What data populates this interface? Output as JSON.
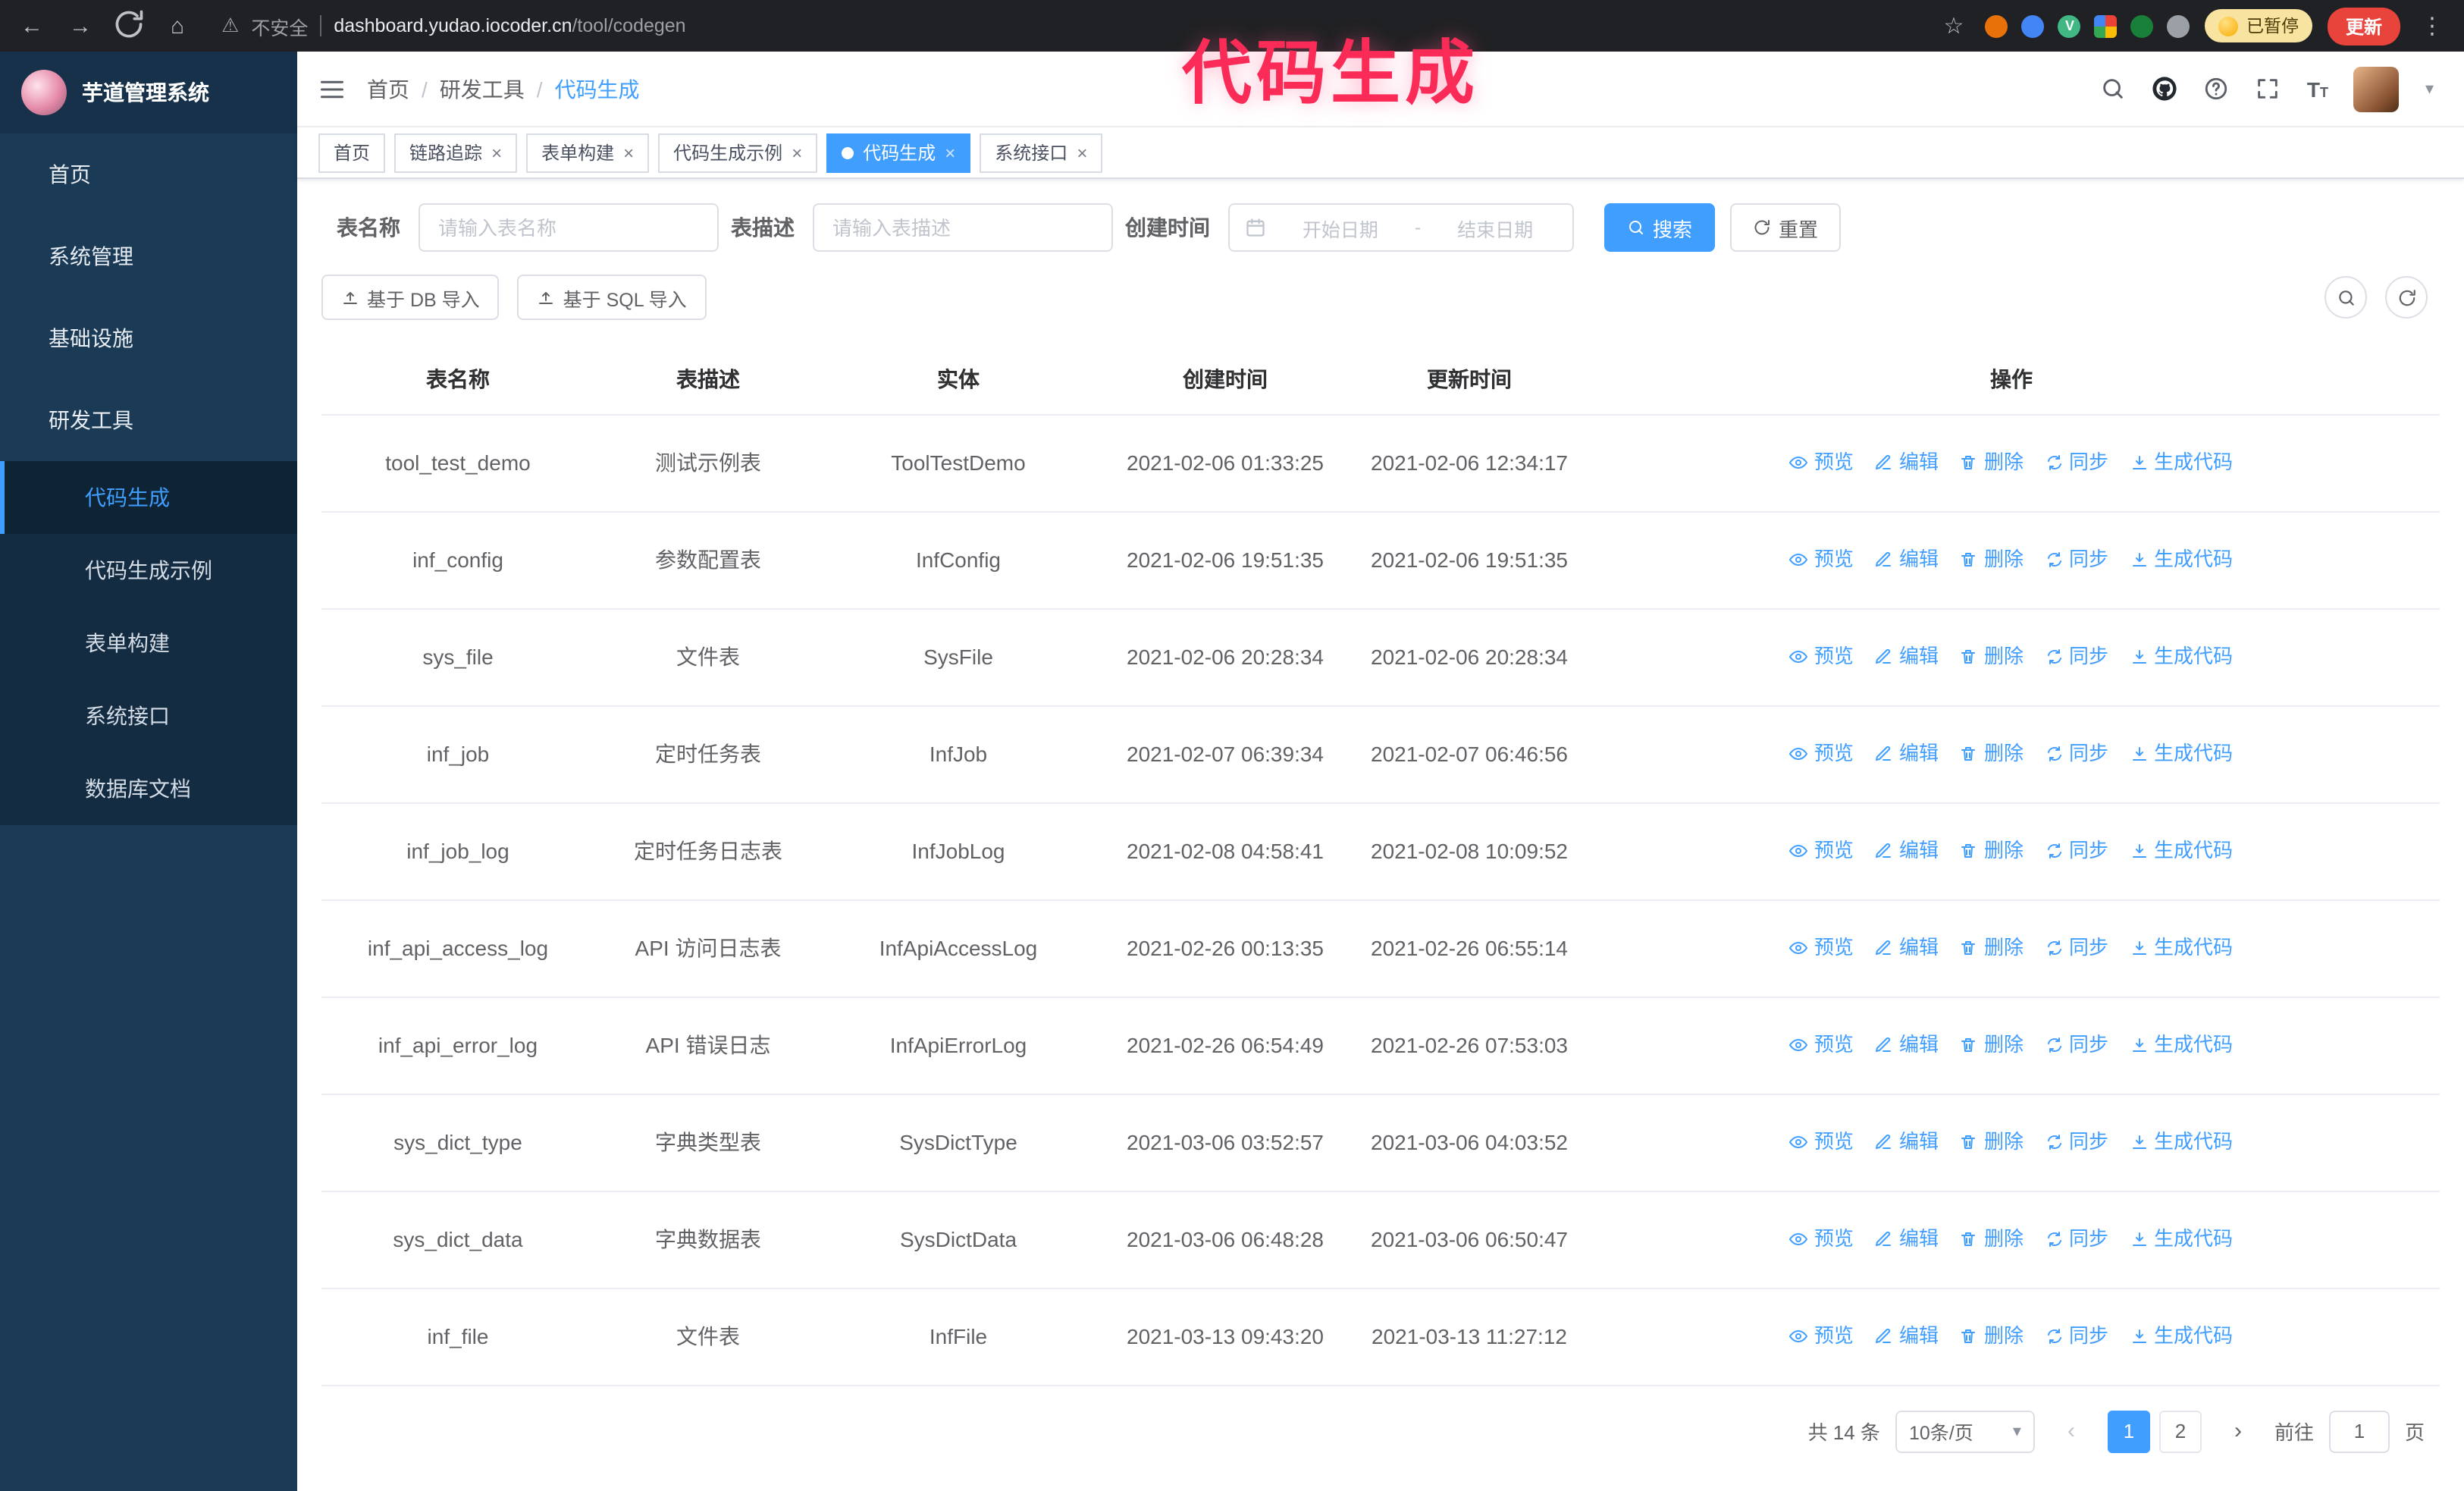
{
  "browser": {
    "security_label": "不安全",
    "url_host": "dashboard.yudao.iocoder.cn",
    "url_path": "/tool/codegen",
    "paused_label": "已暂停",
    "update_label": "更新",
    "extension_icons": [
      "orange-extension-icon",
      "blue-drop-extension-icon",
      "vue-devtools-icon",
      "google-apps-grid-icon",
      "green-extension-icon",
      "puzzle-extension-icon"
    ]
  },
  "annotation": {
    "text": "代码生成",
    "color": "#fb2b57"
  },
  "sidebar": {
    "app_title": "芋道管理系统",
    "items": [
      {
        "id": "home",
        "label": "首页",
        "icon": "dashboard",
        "expandable": false,
        "expanded": false
      },
      {
        "id": "system",
        "label": "系统管理",
        "icon": "gear",
        "expandable": true,
        "expanded": false
      },
      {
        "id": "infra",
        "label": "基础设施",
        "icon": "monitor",
        "expandable": true,
        "expanded": false
      },
      {
        "id": "devtools",
        "label": "研发工具",
        "icon": "toolbox",
        "expandable": true,
        "expanded": true
      }
    ],
    "submenu": [
      {
        "id": "codegen",
        "label": "代码生成",
        "icon": "code",
        "active": true
      },
      {
        "id": "codegen-example",
        "label": "代码生成示例",
        "icon": "shield-check",
        "active": false
      },
      {
        "id": "form-builder",
        "label": "表单构建",
        "icon": "table",
        "active": false
      },
      {
        "id": "api",
        "label": "系统接口",
        "icon": "api-list",
        "active": false
      },
      {
        "id": "db-doc",
        "label": "数据库文档",
        "icon": "grid",
        "active": false
      }
    ]
  },
  "navbar": {
    "breadcrumb": [
      "首页",
      "研发工具",
      "代码生成"
    ]
  },
  "tabs": [
    {
      "id": "home",
      "label": "首页",
      "closable": false,
      "active": false
    },
    {
      "id": "trace",
      "label": "链路追踪",
      "closable": true,
      "active": false
    },
    {
      "id": "form-builder",
      "label": "表单构建",
      "closable": true,
      "active": false
    },
    {
      "id": "codegen-example",
      "label": "代码生成示例",
      "closable": true,
      "active": false
    },
    {
      "id": "codegen",
      "label": "代码生成",
      "closable": true,
      "active": true
    },
    {
      "id": "api",
      "label": "系统接口",
      "closable": true,
      "active": false
    }
  ],
  "filters": {
    "table_name_label": "表名称",
    "table_name_placeholder": "请输入表名称",
    "table_desc_label": "表描述",
    "table_desc_placeholder": "请输入表描述",
    "create_time_label": "创建时间",
    "start_date_placeholder": "开始日期",
    "range_separator": "-",
    "end_date_placeholder": "结束日期",
    "search_label": "搜索",
    "reset_label": "重置"
  },
  "toolbar": {
    "import_db_label": "基于 DB 导入",
    "import_sql_label": "基于 SQL 导入"
  },
  "table": {
    "columns": [
      "表名称",
      "表描述",
      "实体",
      "创建时间",
      "更新时间",
      "操作"
    ],
    "actions": [
      {
        "id": "preview",
        "label": "预览",
        "icon": "eye"
      },
      {
        "id": "edit",
        "label": "编辑",
        "icon": "edit"
      },
      {
        "id": "delete",
        "label": "删除",
        "icon": "trash"
      },
      {
        "id": "sync",
        "label": "同步",
        "icon": "sync"
      },
      {
        "id": "generate",
        "label": "生成代码",
        "icon": "generate"
      }
    ],
    "rows": [
      {
        "name": "tool_test_demo",
        "desc": "测试示例表",
        "entity": "ToolTestDemo",
        "created": "2021-02-06 01:33:25",
        "updated": "2021-02-06 12:34:17"
      },
      {
        "name": "inf_config",
        "desc": "参数配置表",
        "entity": "InfConfig",
        "created": "2021-02-06 19:51:35",
        "updated": "2021-02-06 19:51:35"
      },
      {
        "name": "sys_file",
        "desc": "文件表",
        "entity": "SysFile",
        "created": "2021-02-06 20:28:34",
        "updated": "2021-02-06 20:28:34"
      },
      {
        "name": "inf_job",
        "desc": "定时任务表",
        "entity": "InfJob",
        "created": "2021-02-07 06:39:34",
        "updated": "2021-02-07 06:46:56"
      },
      {
        "name": "inf_job_log",
        "desc": "定时任务日志表",
        "entity": "InfJobLog",
        "created": "2021-02-08 04:58:41",
        "updated": "2021-02-08 10:09:52"
      },
      {
        "name": "inf_api_access_log",
        "desc": "API 访问日志表",
        "entity": "InfApiAccessLog",
        "created": "2021-02-26 00:13:35",
        "updated": "2021-02-26 06:55:14"
      },
      {
        "name": "inf_api_error_log",
        "desc": "API 错误日志",
        "entity": "InfApiErrorLog",
        "created": "2021-02-26 06:54:49",
        "updated": "2021-02-26 07:53:03"
      },
      {
        "name": "sys_dict_type",
        "desc": "字典类型表",
        "entity": "SysDictType",
        "created": "2021-03-06 03:52:57",
        "updated": "2021-03-06 04:03:52"
      },
      {
        "name": "sys_dict_data",
        "desc": "字典数据表",
        "entity": "SysDictData",
        "created": "2021-03-06 06:48:28",
        "updated": "2021-03-06 06:50:47"
      },
      {
        "name": "inf_file",
        "desc": "文件表",
        "entity": "InfFile",
        "created": "2021-03-13 09:43:20",
        "updated": "2021-03-13 11:27:12"
      }
    ]
  },
  "pagination": {
    "total_text": "共 14 条",
    "page_size": "10条/页",
    "pages": [
      "1",
      "2"
    ],
    "active_page": "1",
    "prev_glyph": "‹",
    "next_glyph": "›",
    "goto_label": "前往",
    "goto_value": "1",
    "page_suffix": "页"
  },
  "colors": {
    "primary": "#409eff",
    "sidebar_bg": "#1b3a55",
    "annotation": "#fb2b57",
    "update_button": "#e8443c",
    "paused_badge": "#f8e3a1"
  }
}
